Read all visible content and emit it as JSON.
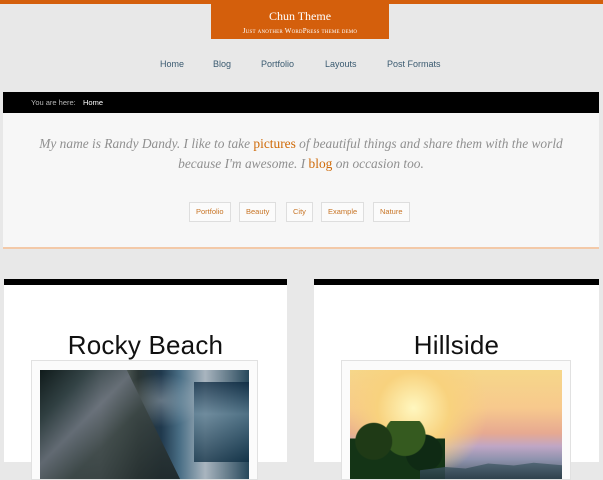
{
  "site": {
    "title": "Chun Theme",
    "tagline": "Just another WordPress theme demo",
    "accent": "#d45f0c"
  },
  "nav": {
    "items": [
      {
        "label": "Home"
      },
      {
        "label": "Blog"
      },
      {
        "label": "Portfolio"
      },
      {
        "label": "Layouts"
      },
      {
        "label": "Post Formats"
      }
    ]
  },
  "breadcrumb": {
    "prefix": "You are here:",
    "current": "Home"
  },
  "intro": {
    "part1": "My name is Randy Dandy. I like to take ",
    "link1": "pictures",
    "part2": " of beautiful things and share them with the world because I'm awesome. I ",
    "link2": "blog",
    "part3": " on occasion too."
  },
  "tags": [
    {
      "label": "Portfolio"
    },
    {
      "label": "Beauty"
    },
    {
      "label": "City"
    },
    {
      "label": "Example"
    },
    {
      "label": "Nature"
    }
  ],
  "posts": [
    {
      "title": "Rocky Beach",
      "image": "rocky-beach-photo"
    },
    {
      "title": "Hillside",
      "image": "hillside-photo"
    }
  ],
  "colors": {
    "link": "#cf6a08",
    "black": "#000000",
    "background": "#e8e8e8"
  }
}
